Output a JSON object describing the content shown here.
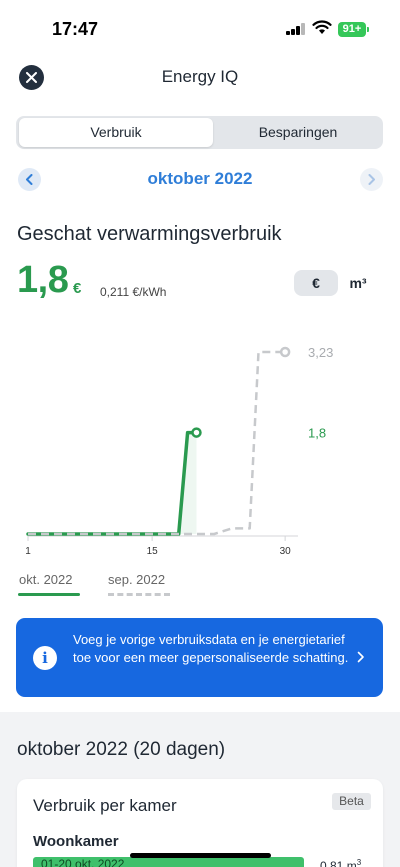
{
  "status_bar": {
    "time": "17:47",
    "battery": "91+"
  },
  "header": {
    "title": "Energy IQ",
    "close_icon": "close-icon"
  },
  "tabs": [
    {
      "label": "Verbruik",
      "active": true
    },
    {
      "label": "Besparingen",
      "active": false
    }
  ],
  "month_nav": {
    "label": "oktober 2022",
    "prev_icon": "chevron-left-icon",
    "next_icon": "chevron-right-icon"
  },
  "section": {
    "title": "Geschat verwarmingsverbruik",
    "value": "1,8",
    "unit": "€",
    "tariff": "0,211 €/kWh"
  },
  "unit_toggle": [
    {
      "label": "€",
      "active": true
    },
    {
      "label": "m³",
      "active": false
    }
  ],
  "chart_data": {
    "type": "line",
    "x_ticks": [
      "1",
      "15",
      "30"
    ],
    "xlim": [
      1,
      31
    ],
    "ylim": [
      0,
      3.23
    ],
    "series": [
      {
        "name": "okt. 2022",
        "style": "solid",
        "color": "#2a9a4f",
        "end_label": "1,8",
        "points": [
          [
            1,
            0
          ],
          [
            2,
            0
          ],
          [
            3,
            0
          ],
          [
            4,
            0
          ],
          [
            5,
            0
          ],
          [
            6,
            0
          ],
          [
            7,
            0
          ],
          [
            8,
            0
          ],
          [
            9,
            0
          ],
          [
            10,
            0
          ],
          [
            11,
            0
          ],
          [
            12,
            0
          ],
          [
            13,
            0
          ],
          [
            14,
            0
          ],
          [
            15,
            0
          ],
          [
            16,
            0
          ],
          [
            17,
            0
          ],
          [
            18,
            0
          ],
          [
            19,
            1.8
          ],
          [
            20,
            1.8
          ]
        ]
      },
      {
        "name": "sep. 2022",
        "style": "dashed",
        "color": "#c7c9cc",
        "end_label": "3,23",
        "points": [
          [
            1,
            0
          ],
          [
            5,
            0
          ],
          [
            10,
            0
          ],
          [
            15,
            0
          ],
          [
            18,
            0
          ],
          [
            20,
            0
          ],
          [
            22,
            0
          ],
          [
            24,
            0.1
          ],
          [
            26,
            0.1
          ],
          [
            27,
            3.23
          ],
          [
            30,
            3.23
          ]
        ]
      }
    ]
  },
  "legend": [
    {
      "label": "okt. 2022",
      "color": "#2a9a4f"
    },
    {
      "label": "sep. 2022",
      "color": "#c7c9cc"
    }
  ],
  "info_banner": {
    "text": "Voeg je vorige verbruiksdata en je energietarief toe voor een meer gepersonaliseerde schatting.",
    "icon": "info-icon",
    "chevron": "chevron-right-icon"
  },
  "period": {
    "title": "oktober 2022 (20 dagen)"
  },
  "room_card": {
    "title": "Verbruik per kamer",
    "badge": "Beta",
    "rooms": [
      {
        "name": "Woonkamer",
        "bar_label": "01-20 okt. 2022",
        "value": "0,81 m",
        "value_sup": "3"
      }
    ]
  },
  "colors": {
    "accent_blue": "#2f7ed8",
    "green": "#2a9a4f",
    "banner": "#1768e0",
    "dark": "#1f2833"
  }
}
